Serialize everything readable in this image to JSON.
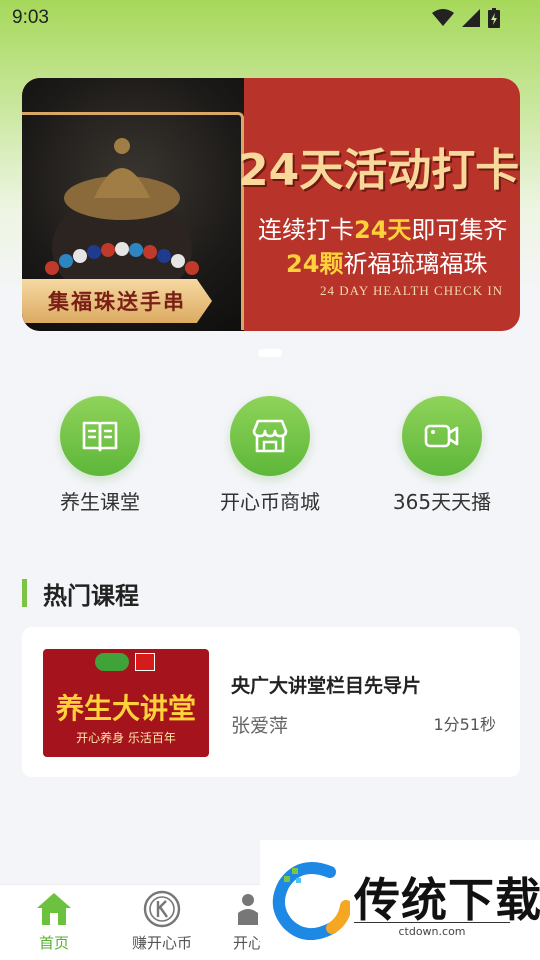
{
  "status": {
    "time": "9:03"
  },
  "banner": {
    "title": "24天活动打卡",
    "line1_pre": "连续打卡",
    "line1_hl": "24天",
    "line1_post": "即可集齐",
    "line2_hl": "24颗",
    "line2_post": "祈福琉璃福珠",
    "english": "24 DAY HEALTH CHECK IN",
    "tag": "集福珠送手串"
  },
  "shortcuts": [
    {
      "label": "养生课堂",
      "icon": "book-icon"
    },
    {
      "label": "开心币商城",
      "icon": "store-icon"
    },
    {
      "label": "365天天播",
      "icon": "video-icon"
    }
  ],
  "section": {
    "title": "热门课程"
  },
  "course": {
    "thumb_title": "养生大讲堂",
    "thumb_sub": "开心养身 乐活百年",
    "title": "央广大讲堂栏目先导片",
    "author": "张爱萍",
    "duration": "1分51秒"
  },
  "tabs": [
    {
      "label": "首页",
      "icon": "home-icon",
      "active": true
    },
    {
      "label": "赚开心币",
      "icon": "coin-icon",
      "active": false
    },
    {
      "label": "开心",
      "icon": "person-icon",
      "active": false
    }
  ],
  "watermark": {
    "brand": "传统下载",
    "url": "ctdown.com"
  },
  "colors": {
    "accent": "#5db73a",
    "banner": "#b8332a"
  }
}
